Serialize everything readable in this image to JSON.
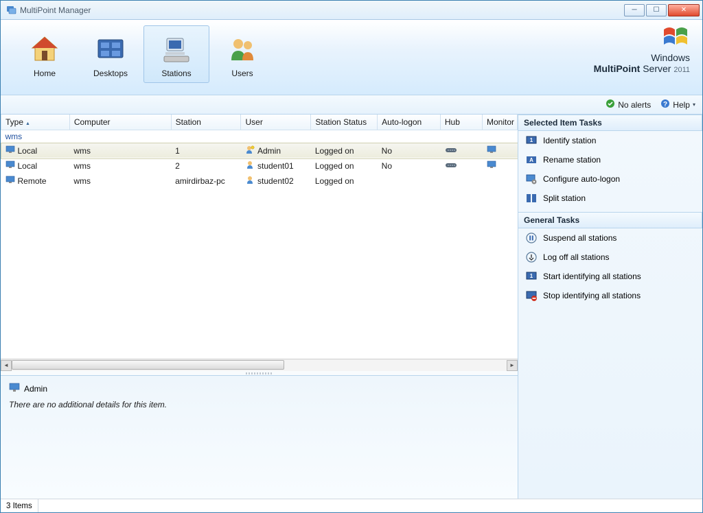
{
  "window": {
    "title": "MultiPoint Manager"
  },
  "tabs": {
    "home": "Home",
    "desktops": "Desktops",
    "stations": "Stations",
    "users": "Users"
  },
  "brand": {
    "line1": "Windows",
    "line2_a": "MultiPoint",
    "line2_b": "Server",
    "year": "2011"
  },
  "statusbar": {
    "no_alerts": "No alerts",
    "help": "Help"
  },
  "columns": {
    "type": "Type",
    "computer": "Computer",
    "station": "Station",
    "user": "User",
    "status": "Station Status",
    "autologon": "Auto-logon",
    "hub": "Hub",
    "monitor": "Monitor"
  },
  "group": {
    "name": "wms"
  },
  "rows": [
    {
      "type": "Local",
      "computer": "wms",
      "station": "1",
      "user": "Admin",
      "status": "Logged on",
      "autologon": "No",
      "hub": true,
      "monitor": true,
      "userIcon": "admin"
    },
    {
      "type": "Local",
      "computer": "wms",
      "station": "2",
      "user": "student01",
      "status": "Logged on",
      "autologon": "No",
      "hub": true,
      "monitor": true,
      "userIcon": "user"
    },
    {
      "type": "Remote",
      "computer": "wms",
      "station": "amirdirbaz-pc",
      "user": "student02",
      "status": "Logged on",
      "autologon": "",
      "hub": false,
      "monitor": false,
      "userIcon": "user"
    }
  ],
  "details": {
    "name": "Admin",
    "message": "There are no additional details for this item."
  },
  "right": {
    "selected_header": "Selected Item Tasks",
    "general_header": "General Tasks",
    "identify": "Identify station",
    "rename": "Rename station",
    "configure": "Configure auto-logon",
    "split": "Split station",
    "suspend": "Suspend all stations",
    "logoff": "Log off all stations",
    "startid": "Start identifying all stations",
    "stopid": "Stop identifying all stations"
  },
  "footer": {
    "count": "3 Items"
  }
}
